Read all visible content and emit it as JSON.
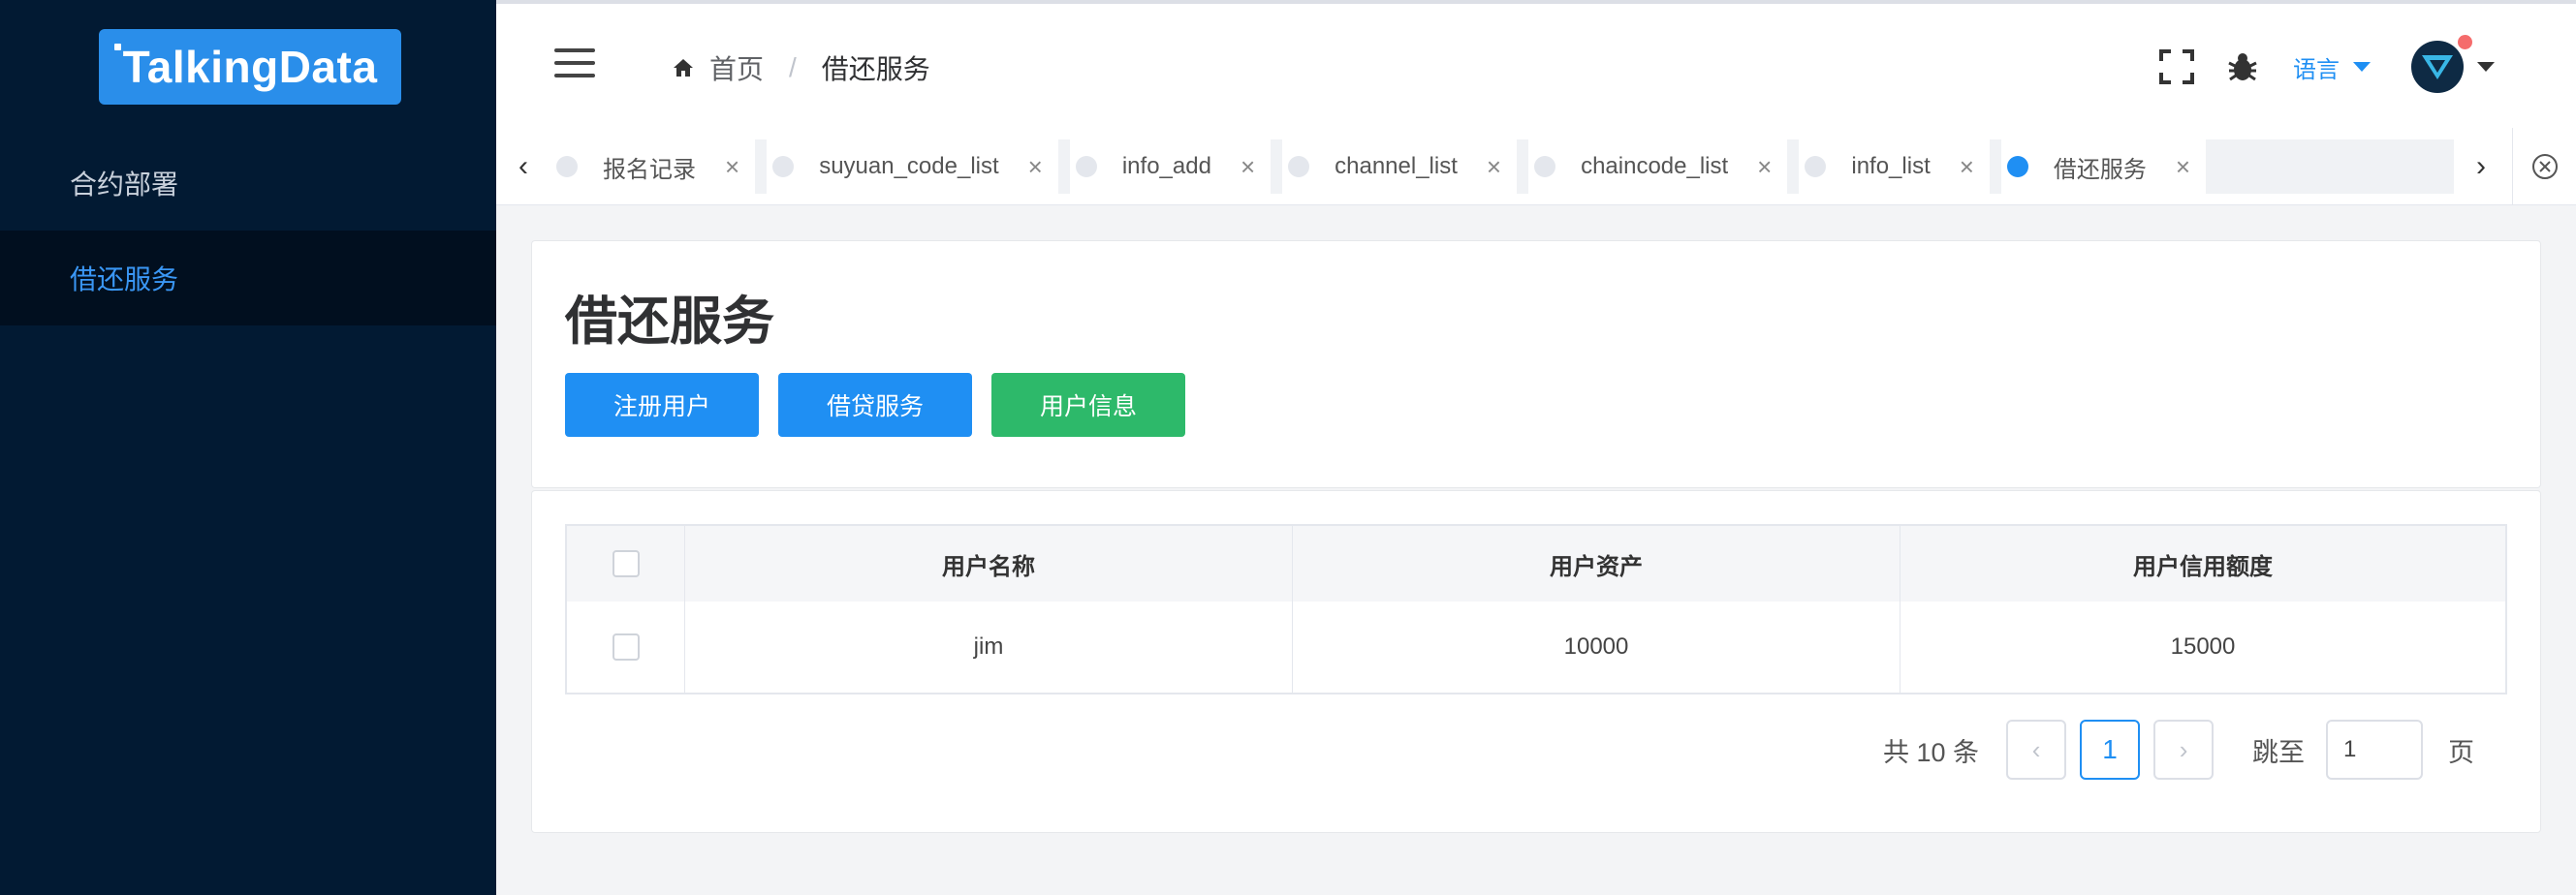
{
  "sidebar": {
    "logo_text": "TalkingData",
    "items": [
      {
        "label": "合约部署"
      },
      {
        "label": "借还服务"
      }
    ]
  },
  "navbar": {
    "breadcrumb": {
      "home": "首页",
      "separator": "/",
      "current": "借还服务"
    },
    "language_label": "语言",
    "icons": [
      "hamburger-icon",
      "home-icon",
      "fullscreen-icon",
      "bug-icon",
      "avatar",
      "caret-down-icon"
    ]
  },
  "tags": [
    {
      "label": "报名记录",
      "active": false
    },
    {
      "label": "suyuan_code_list",
      "active": false
    },
    {
      "label": "info_add",
      "active": false
    },
    {
      "label": "channel_list",
      "active": false
    },
    {
      "label": "chaincode_list",
      "active": false
    },
    {
      "label": "info_list",
      "active": false
    },
    {
      "label": "借还服务",
      "active": true
    }
  ],
  "page": {
    "title": "借还服务",
    "buttons": {
      "register": "注册用户",
      "loan": "借贷服务",
      "user_info": "用户信息"
    }
  },
  "table": {
    "headers": [
      "用户名称",
      "用户资产",
      "用户信用额度"
    ],
    "rows": [
      [
        "jim",
        "10000",
        "15000"
      ]
    ]
  },
  "pagination": {
    "total_text": "共 10 条",
    "current_page": "1",
    "jump_label": "跳至",
    "jump_value": "1",
    "page_unit": "页"
  },
  "colors": {
    "sidebar_bg": "#021a33",
    "accent": "#1f8ff3",
    "success": "#2db96a"
  }
}
